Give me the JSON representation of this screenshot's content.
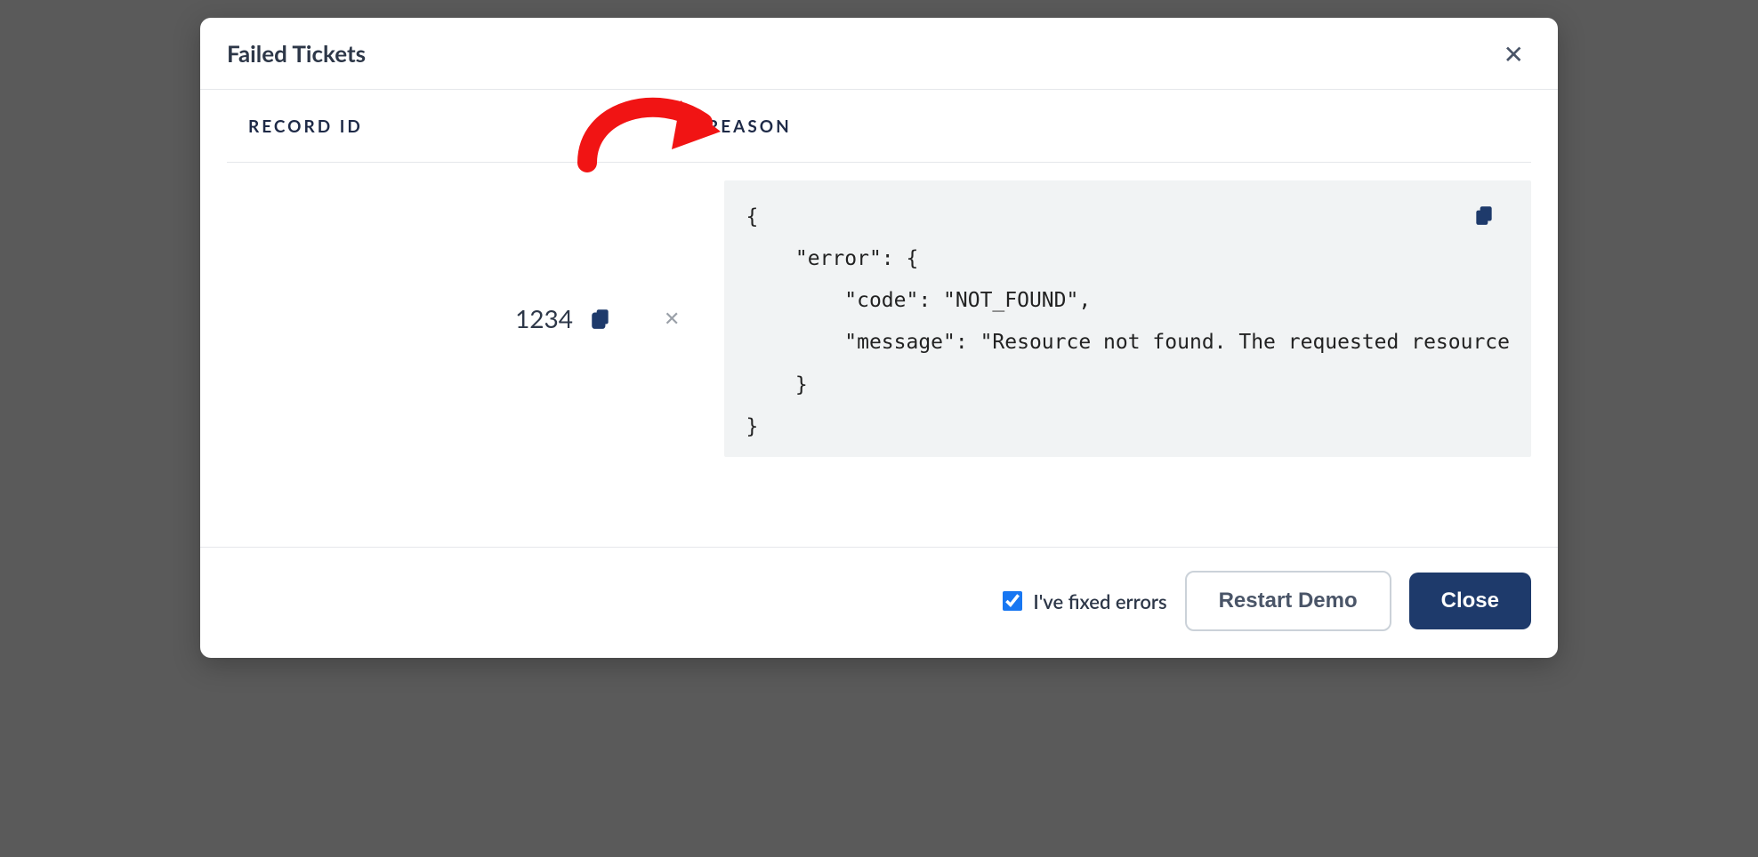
{
  "modal": {
    "title": "Failed Tickets"
  },
  "table": {
    "headers": {
      "record_id": "RECORD ID",
      "reason": "REASON"
    },
    "rows": [
      {
        "record_id": "1234",
        "reason_code": "{\n    \"error\": {\n        \"code\": \"NOT_FOUND\",\n        \"message\": \"Resource not found. The requested resource\n    }\n}"
      }
    ]
  },
  "footer": {
    "fixed_label": "I've fixed errors",
    "fixed_checked": true,
    "restart_label": "Restart Demo",
    "close_label": "Close"
  }
}
